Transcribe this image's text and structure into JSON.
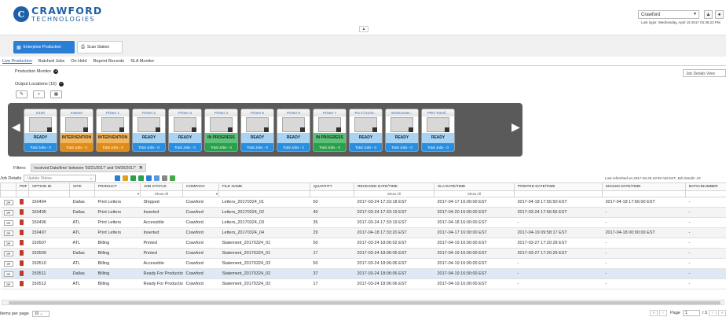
{
  "header": {
    "logo_line1": "CRAWFORD",
    "logo_line2": "TECHNOLOGIES",
    "user": "Crawford",
    "last_login": "Last login: Wednesday, April 19 2017 04:36:23 PM"
  },
  "app_tabs": [
    {
      "label": "Enterprise Production",
      "icon": "factory-icon"
    },
    {
      "label": "Scan Station",
      "icon": "scanner-icon"
    }
  ],
  "subnav": [
    "Live Production",
    "Batched Jobs",
    "On Hold",
    "Reprint Records",
    "SLA Monitor"
  ],
  "production_monitor": "Production Monitor",
  "job_details_view": "Job Details View",
  "output_locations": "Output Locations (16)",
  "toolbar_icons": [
    "edit-icon",
    "add-icon",
    "calendar-icon"
  ],
  "locations": [
    {
      "name": "D100",
      "status": "READY",
      "total": "Total Jobs - 0",
      "color": "blue"
    },
    {
      "name": "Inserter",
      "status": "INTERVENTION",
      "total": "Total Jobs - 0",
      "color": "orange"
    },
    {
      "name": "Printer 1",
      "status": "INTERVENTION",
      "total": "Total Jobs - 0",
      "color": "orange"
    },
    {
      "name": "Printer 2",
      "status": "READY",
      "total": "Total Jobs - 0",
      "color": "blue"
    },
    {
      "name": "Printer 3",
      "status": "READY",
      "total": "Total Jobs - 0",
      "color": "blue"
    },
    {
      "name": "Printer 4",
      "status": "IN PROGRESS",
      "total": "Total Jobs - 0",
      "color": "green"
    },
    {
      "name": "Printer 5",
      "status": "READY",
      "total": "Total Jobs - 0",
      "color": "blue"
    },
    {
      "name": "Printer 6",
      "status": "READY",
      "total": "Total Jobs - 2",
      "color": "blue"
    },
    {
      "name": "Printer 7",
      "status": "IN PROGRESS",
      "total": "Total Jobs - 0",
      "color": "green"
    },
    {
      "name": "Pro C7110X...",
      "status": "READY",
      "total": "Total Jobs - 0",
      "color": "blue"
    },
    {
      "name": "WorkCenter...",
      "status": "READY",
      "total": "Total Jobs - 0",
      "color": "blue"
    },
    {
      "name": "PRO Transf...",
      "status": "READY",
      "total": "Total Jobs - 0",
      "color": "blue"
    }
  ],
  "filters": {
    "label": "Filters:",
    "chip": "'received Date/time' between '03/21/2017' and '04/20/2017'"
  },
  "job_details": {
    "label": "Job Details",
    "update_placeholder": "Update Status",
    "last_refreshed": "Last refreshed on 2017-04-20 10:59 AM EST, Job Details: 23"
  },
  "table": {
    "columns": [
      "",
      "PDF",
      "OPTION ID",
      "SITE",
      "PRODUCT",
      "JOB STATUS",
      "COMPANY",
      "FILE NAME",
      "QUANTITY",
      "RECEIVED DATE/TIME",
      "SLA DATE/TIME",
      "PRINTED DATE/TIME",
      "MAILED DATE/TIME",
      "BATCHNUMBER"
    ],
    "show_all": "Show All",
    "rows": [
      [
        "150494",
        "Dallas",
        "Print Letters",
        "Shipped",
        "Crawford",
        "Letters_20170324_01",
        "50",
        "2017-03-24 17:33:18 EST",
        "2017-04-17 16:00:00 EST",
        "2017-04-18 17:55:50 EST",
        "2017-04-18 17:56:00 EST",
        "-"
      ],
      [
        "150495",
        "Dallas",
        "Print Letters",
        "Inserted",
        "Crawford",
        "Letters_20170324_02",
        "40",
        "2017-03-24 17:33:19 EST",
        "2017-04-20 16:00:00 EST",
        "2017-03-24 17:56:56 EST",
        "-",
        "-"
      ],
      [
        "150496",
        "ATL",
        "Print Letters",
        "Accessible",
        "Crawford",
        "Letters_20170324_03",
        "35",
        "2017-03-24 17:33:19 EST",
        "2017-04-18 16:00:00 EST",
        "-",
        "-",
        "-"
      ],
      [
        "150497",
        "ATL",
        "Print Letters",
        "Inserted",
        "Crawford",
        "Letters_20170324_04",
        "29",
        "2017-04-18 17:33:20 EST",
        "2017-04-17 16:00:00 EST",
        "2017-04-19 09:58:17 EST",
        "2017-04-18 00:00:00 EST",
        "-"
      ],
      [
        "150507",
        "ATL",
        "Billing",
        "Printed",
        "Crawford",
        "Statement_20170324_01",
        "50",
        "2017-03-24 18:06:02 EST",
        "2017-04-19 16:00:00 EST",
        "2017-03-27 17:20:28 EST",
        "-",
        "-"
      ],
      [
        "150509",
        "Dallas",
        "Billing",
        "Printed",
        "Crawford",
        "Statement_20170324_01",
        "17",
        "2017-03-24 18:06:05 EST",
        "2017-04-19 16:00:00 EST",
        "2017-03-27 17:20:29 EST",
        "-",
        "-"
      ],
      [
        "150510",
        "ATL",
        "Billing",
        "Accessible",
        "Crawford",
        "Statement_20170324_02",
        "50",
        "2017-03-24 18:06:06 EST",
        "2017-04-19 16:00:00 EST",
        "-",
        "-",
        "-"
      ],
      [
        "150511",
        "Dallas",
        "Billing",
        "Ready For Production",
        "Crawford",
        "Statement_20170324_02",
        "37",
        "2017-03-24 18:06:06 EST",
        "2017-04-19 16:00:00 EST",
        "-",
        "-",
        "-"
      ],
      [
        "150512",
        "ATL",
        "Billing",
        "Ready For Production",
        "Crawford",
        "Statement_20170324_02",
        "17",
        "2017-03-24 18:06:06 EST",
        "2017-04-19 16:00:00 EST",
        "-",
        "-",
        "-"
      ]
    ]
  },
  "footer": {
    "items_per_page": "Items per page",
    "per_page_value": "10",
    "page_label": "Page",
    "page_value": "1",
    "of_pages": "/ 3"
  }
}
